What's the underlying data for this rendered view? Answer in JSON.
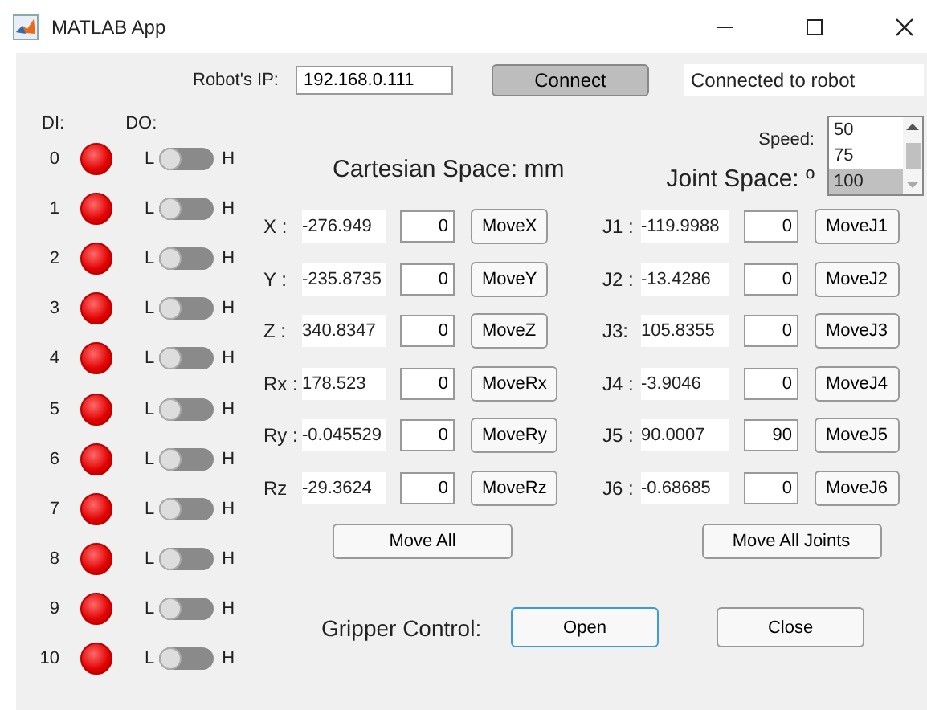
{
  "window": {
    "title": "MATLAB App"
  },
  "connection": {
    "ip_label": "Robot's IP:",
    "ip_value": "192.168.0.111",
    "connect_button": "Connect",
    "status": "Connected to robot"
  },
  "io": {
    "di_header": "DI:",
    "do_header": "DO:",
    "rows": [
      {
        "index": "0",
        "di_on": false,
        "low": "L",
        "high": "H",
        "do_on": false
      },
      {
        "index": "1",
        "di_on": false,
        "low": "L",
        "high": "H",
        "do_on": false
      },
      {
        "index": "2",
        "di_on": false,
        "low": "L",
        "high": "H",
        "do_on": false
      },
      {
        "index": "3",
        "di_on": false,
        "low": "L",
        "high": "H",
        "do_on": false
      },
      {
        "index": "4",
        "di_on": false,
        "low": "L",
        "high": "H",
        "do_on": false
      },
      {
        "index": "5",
        "di_on": false,
        "low": "L",
        "high": "H",
        "do_on": false
      },
      {
        "index": "6",
        "di_on": false,
        "low": "L",
        "high": "H",
        "do_on": false
      },
      {
        "index": "7",
        "di_on": false,
        "low": "L",
        "high": "H",
        "do_on": false
      },
      {
        "index": "8",
        "di_on": false,
        "low": "L",
        "high": "H",
        "do_on": false
      },
      {
        "index": "9",
        "di_on": false,
        "low": "L",
        "high": "H",
        "do_on": false
      },
      {
        "index": "10",
        "di_on": false,
        "low": "L",
        "high": "H",
        "do_on": false
      }
    ]
  },
  "speed": {
    "label": "Speed:",
    "options": [
      {
        "label": "50",
        "selected": false
      },
      {
        "label": "75",
        "selected": false
      },
      {
        "label": "100",
        "selected": true
      }
    ]
  },
  "cartesian": {
    "title": "Cartesian Space: mm",
    "rows": [
      {
        "label": "X :",
        "value": "-276.949",
        "input": "0",
        "button": "MoveX"
      },
      {
        "label": "Y :",
        "value": "-235.8735",
        "input": "0",
        "button": "MoveY"
      },
      {
        "label": "Z :",
        "value": "340.8347",
        "input": "0",
        "button": "MoveZ"
      },
      {
        "label": "Rx :",
        "value": "178.523",
        "input": "0",
        "button": "MoveRx"
      },
      {
        "label": "Ry :",
        "value": "-0.045529",
        "input": "0",
        "button": "MoveRy"
      },
      {
        "label": "Rz",
        "value": "-29.3624",
        "input": "0",
        "button": "MoveRz"
      }
    ],
    "move_all": "Move All"
  },
  "joint": {
    "title": "Joint Space: º",
    "rows": [
      {
        "label": "J1 :",
        "value": "-119.9988",
        "input": "0",
        "button": "MoveJ1"
      },
      {
        "label": "J2 :",
        "value": "-13.4286",
        "input": "0",
        "button": "MoveJ2"
      },
      {
        "label": "J3:",
        "value": "105.8355",
        "input": "0",
        "button": "MoveJ3"
      },
      {
        "label": "J4 :",
        "value": "-3.9046",
        "input": "0",
        "button": "MoveJ4"
      },
      {
        "label": "J5 :",
        "value": "90.0007",
        "input": "90",
        "button": "MoveJ5"
      },
      {
        "label": "J6 :",
        "value": "-0.68685",
        "input": "0",
        "button": "MoveJ6"
      }
    ],
    "move_all": "Move All Joints"
  },
  "gripper": {
    "label": "Gripper Control:",
    "buttons": [
      {
        "label": "Open",
        "focused": true
      },
      {
        "label": "Close",
        "focused": false
      }
    ]
  }
}
